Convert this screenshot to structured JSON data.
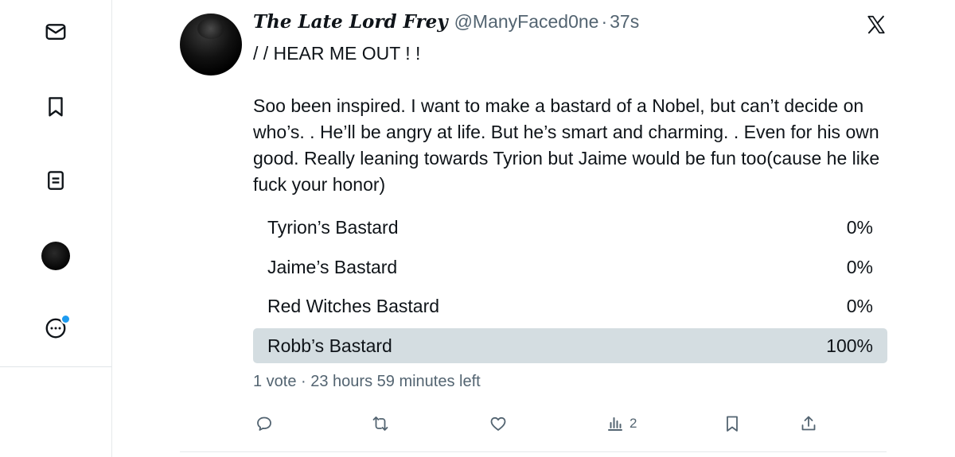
{
  "sidebar": {
    "items": [
      {
        "name": "messages",
        "icon": "mail-icon"
      },
      {
        "name": "bookmarks",
        "icon": "bookmark-icon"
      },
      {
        "name": "lists",
        "icon": "list-icon"
      },
      {
        "name": "profile",
        "icon": "avatar"
      },
      {
        "name": "more",
        "icon": "more-icon"
      }
    ]
  },
  "tweet": {
    "display_name": "The Late Lord Frey",
    "handle": "@ManyFaced0ne",
    "separator": "·",
    "time": "37s",
    "text_line1": "/ / HEAR ME OUT ! !",
    "text_para2": "Soo been inspired. I want to make a bastard of a Nobel, but can’t decide on who’s. . He’ll be angry at life. But he’s smart and charming. . Even for his own good. Really leaning towards Tyrion but Jaime would be fun too(cause he like fuck your honor)"
  },
  "poll": {
    "options": [
      {
        "label": "Tyrion’s Bastard",
        "percent_text": "0%",
        "fraction": 0
      },
      {
        "label": "Jaime’s Bastard",
        "percent_text": "0%",
        "fraction": 0
      },
      {
        "label": "Red Witches Bastard",
        "percent_text": "0%",
        "fraction": 0
      },
      {
        "label": "Robb’s Bastard",
        "percent_text": "100%",
        "fraction": 1
      }
    ],
    "meta": "1 vote · 23 hours 59 minutes left"
  },
  "actions": {
    "reply": {
      "icon": "reply-icon"
    },
    "retweet": {
      "icon": "retweet-icon"
    },
    "like": {
      "icon": "heart-icon"
    },
    "views": {
      "icon": "views-icon",
      "count": "2"
    },
    "bookmark": {
      "icon": "bookmark-icon"
    },
    "share": {
      "icon": "share-icon"
    }
  },
  "colors": {
    "text": "#0f1419",
    "secondary": "#536471",
    "poll_fill": "#cfd9de",
    "accent": "#1d9bf0"
  }
}
